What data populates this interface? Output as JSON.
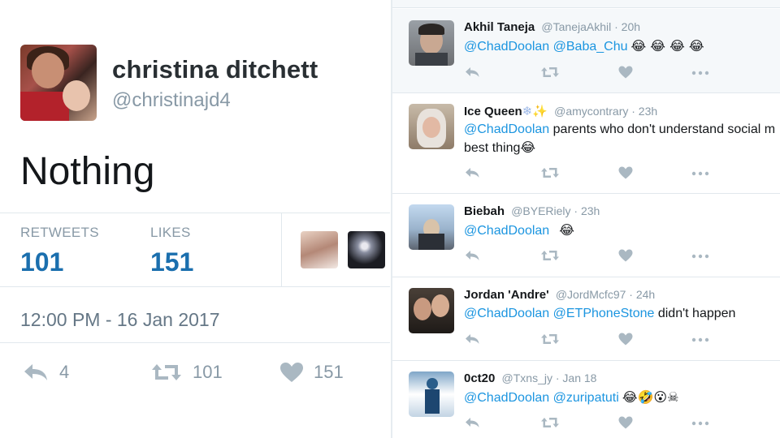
{
  "main_tweet": {
    "display_name": "christina ditchett",
    "handle": "@christinajd4",
    "text": "Nothing",
    "retweets_label": "RETWEETS",
    "retweets_count": "101",
    "likes_label": "LIKES",
    "likes_count": "151",
    "timestamp": "12:00 PM - 16 Jan 2017",
    "reply_count": "4",
    "retweet_action_count": "101",
    "like_action_count": "151"
  },
  "replies": [
    {
      "name": "Akhil Taneja",
      "meta": "@TanejaAkhil · 20h",
      "mentions": "@ChadDoolan @Baba_Chu",
      "text": "",
      "emoji": "😂 😂 😂 😂",
      "line2": ""
    },
    {
      "name": "Ice Queen",
      "name_emoji": "❄✨",
      "meta": "@amycontrary · 23h",
      "mentions": "@ChadDoolan",
      "text": " parents who don't understand social m",
      "emoji": "",
      "line2": "best thing😂"
    },
    {
      "name": "Biebah",
      "meta": "@BYERiely · 23h",
      "mentions": "@ChadDoolan",
      "text": "",
      "emoji": "😂",
      "line2": ""
    },
    {
      "name": "Jordan 'Andre'",
      "meta": "@JordMcfc97 · 24h",
      "mentions": "@ChadDoolan @ETPhoneStone",
      "text": " didn't happen",
      "emoji": "",
      "line2": ""
    },
    {
      "name": "0ct20",
      "meta": "@Txns_jy · Jan 18",
      "mentions": "@ChadDoolan @zuripatuti",
      "text": "",
      "emoji": "😂🤣😮☠",
      "line2": ""
    }
  ],
  "icons": {
    "reply": "reply-icon",
    "retweet": "retweet-icon",
    "like": "heart-icon",
    "more": "more-icon"
  },
  "colors": {
    "link": "#1b95e0",
    "stat_value": "#1b6fae",
    "muted": "#8899a6",
    "divider": "#e1e8ed"
  }
}
